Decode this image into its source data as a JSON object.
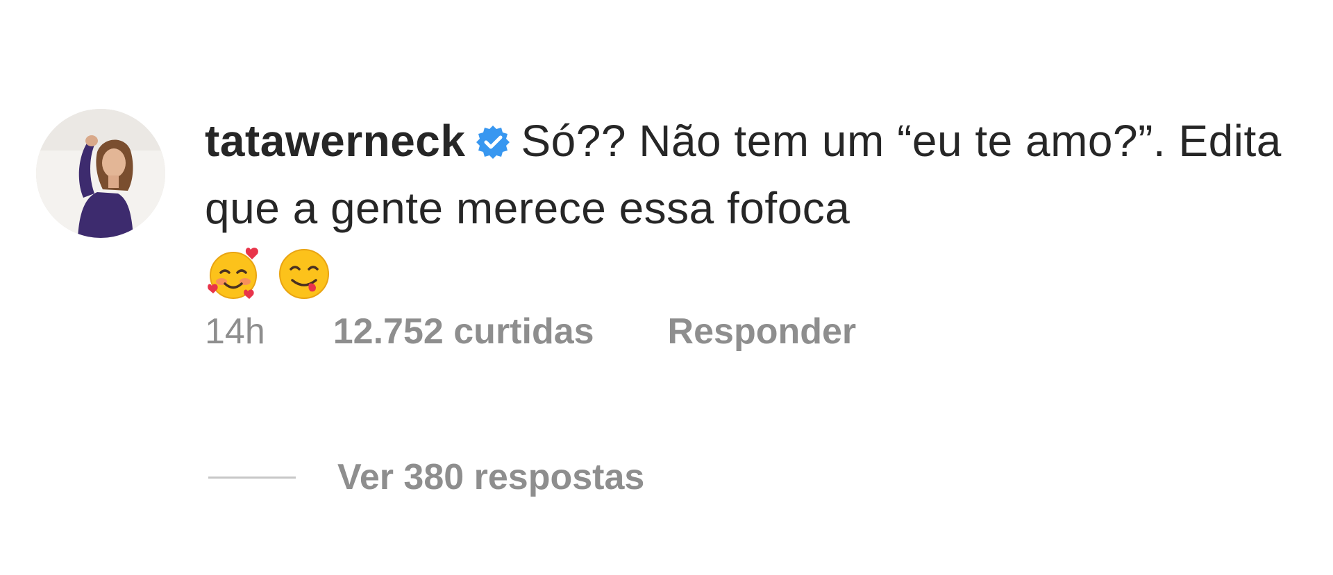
{
  "comment": {
    "avatar_icon": "profile-photo",
    "username": "tatawerneck",
    "verified_icon": "verified-badge-icon",
    "verified_color": "#3897f0",
    "text": "Só?? Não tem um “eu te amo?”. Edita que a gente merece essa fofoca",
    "emojis": [
      "smiling-face-with-hearts-icon",
      "face-savoring-food-icon"
    ],
    "time": "14h",
    "likes": "12.752 curtidas",
    "reply_label": "Responder",
    "view_replies_label": "Ver 380 respostas"
  },
  "colors": {
    "text": "#262626",
    "secondary": "#8e8e8e"
  }
}
